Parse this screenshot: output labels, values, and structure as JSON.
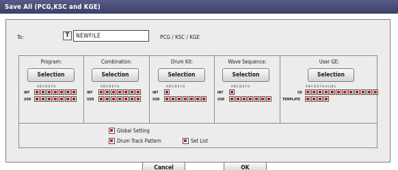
{
  "window": {
    "title": "Save All (PCG,KSC and KGE)"
  },
  "to": {
    "label": "To:",
    "text_button": "T",
    "filename": "NEWFILE",
    "type_text": "PCG / KSC / KGE"
  },
  "categories": [
    {
      "title": "Program:",
      "button": "Selection",
      "letters": "A B C D E F G",
      "rows": [
        {
          "label": "INT",
          "count": 7
        },
        {
          "label": "USR",
          "count": 7
        }
      ]
    },
    {
      "title": "Combination:",
      "button": "Selection",
      "letters": "A B C D E F G",
      "rows": [
        {
          "label": "INT",
          "count": 7
        },
        {
          "label": "USR",
          "count": 7
        }
      ]
    },
    {
      "title": "Drum Kit:",
      "button": "Selection",
      "letters": "A B C D E F G",
      "rows": [
        {
          "label": "INT",
          "count": 1
        },
        {
          "label": "USR",
          "count": 7
        }
      ]
    },
    {
      "title": "Wave Sequence:",
      "button": "Selection",
      "letters": "A B C D E F G",
      "rows": [
        {
          "label": "INT",
          "count": 1
        },
        {
          "label": "USR",
          "count": 7
        }
      ]
    },
    {
      "title": "User GE:",
      "button": "Selection",
      "letters": "A B C D E F G H I J K L",
      "rows": [
        {
          "label": "GE",
          "count": 12
        },
        {
          "label": "TEMPLATE",
          "count": 4
        }
      ]
    }
  ],
  "options": {
    "global_setting": "Global Setting",
    "drum_track_pattern": "Drum Track Pattern",
    "set_list": "Set List"
  },
  "buttons": {
    "cancel": "Cancel",
    "ok": "OK"
  },
  "colors": {
    "titlebar": "#4a507a",
    "checkbox_mark": "#c4161c",
    "dialog_bg": "#ececec"
  }
}
